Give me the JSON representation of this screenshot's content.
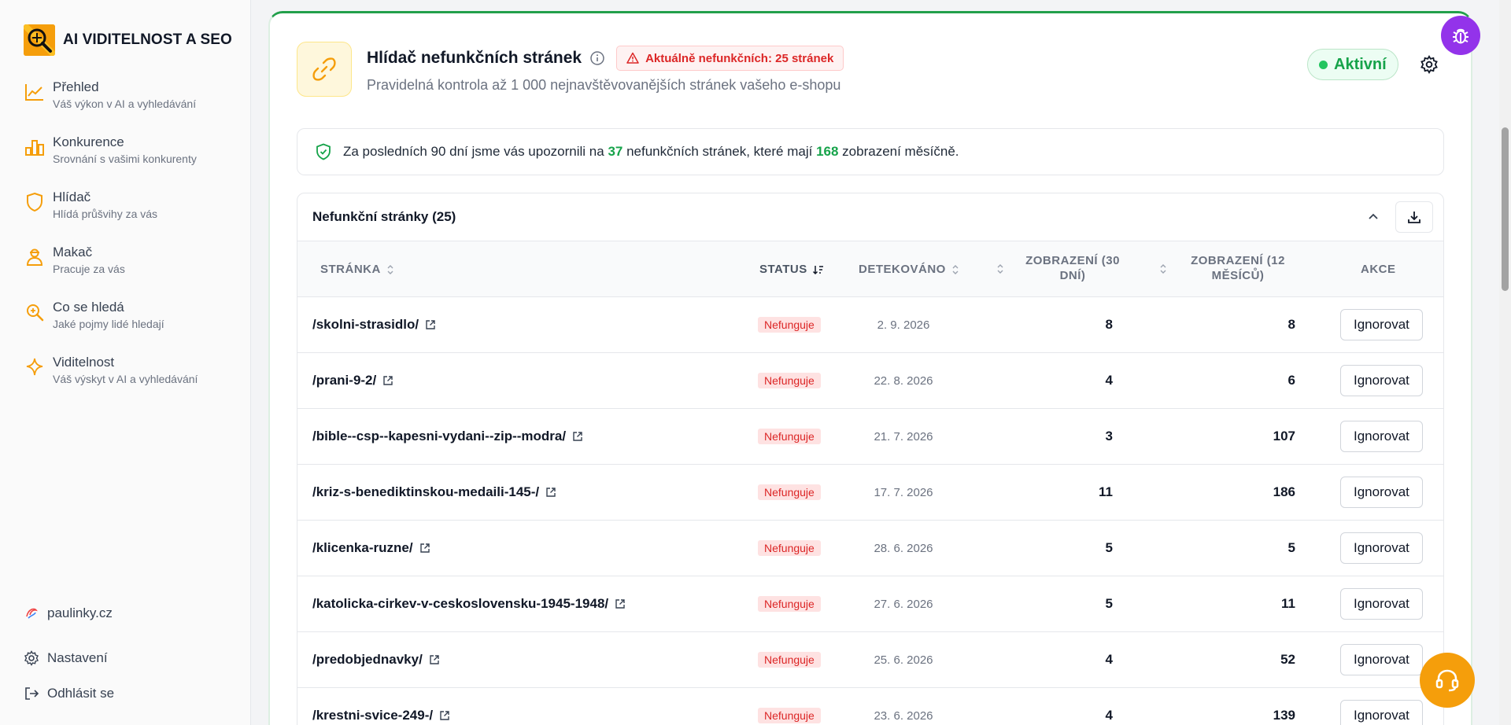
{
  "brand": {
    "name": "AI VIDITELNOST A SEO"
  },
  "nav": [
    {
      "title": "Přehled",
      "sub": "Váš výkon v AI a vyhledávání",
      "icon": "trend-chart-icon"
    },
    {
      "title": "Konkurence",
      "sub": "Srovnání s vašimi konkurenty",
      "icon": "bar-chart-icon"
    },
    {
      "title": "Hlídač",
      "sub": "Hlídá průšvihy za vás",
      "icon": "shield-icon"
    },
    {
      "title": "Makač",
      "sub": "Pracuje za vás",
      "icon": "worker-icon"
    },
    {
      "title": "Co se hledá",
      "sub": "Jaké pojmy lidé hledají",
      "icon": "search-icon"
    },
    {
      "title": "Viditelnost",
      "sub": "Váš výskyt v AI a vyhledávání",
      "icon": "sparkle-icon"
    }
  ],
  "sidebar_bottom": {
    "site": "paulinky.cz",
    "settings": "Nastavení",
    "logout": "Odhlásit se"
  },
  "header": {
    "title": "Hlídač nefunkčních stránek",
    "alert": "Aktuálně nefunkčních: 25 stránek",
    "subtitle": "Pravidelná kontrola až 1 000 nejnavštěvovanějších stránek vašeho e-shopu",
    "status": "Aktivní"
  },
  "notice": {
    "prefix": "Za posledních 90 dní jsme vás upozornili na",
    "pages": "37",
    "middle": "nefunkčních stránek, které mají",
    "views": "168",
    "suffix": "zobrazení měsíčně."
  },
  "table": {
    "title": "Nefunkční stránky (25)",
    "columns": {
      "page": "STRÁNKA",
      "status": "STATUS",
      "detected": "DETEKOVÁNO",
      "views30_l1": "ZOBRAZENÍ (30",
      "views30_l2": "DNÍ)",
      "views12_l1": "ZOBRAZENÍ (12",
      "views12_l2": "MĚSÍCŮ)",
      "actions": "AKCE"
    },
    "rows": [
      {
        "page": "/skolni-strasidlo/",
        "status": "Nefunguje",
        "detected": "2. 9. 2026",
        "v30": "8",
        "v12": "8",
        "action": "Ignorovat"
      },
      {
        "page": "/prani-9-2/",
        "status": "Nefunguje",
        "detected": "22. 8. 2026",
        "v30": "4",
        "v12": "6",
        "action": "Ignorovat"
      },
      {
        "page": "/bible--csp--kapesni-vydani--zip--modra/",
        "status": "Nefunguje",
        "detected": "21. 7. 2026",
        "v30": "3",
        "v12": "107",
        "action": "Ignorovat"
      },
      {
        "page": "/kriz-s-benediktinskou-medaili-145-/",
        "status": "Nefunguje",
        "detected": "17. 7. 2026",
        "v30": "11",
        "v12": "186",
        "action": "Ignorovat"
      },
      {
        "page": "/klicenka-ruzne/",
        "status": "Nefunguje",
        "detected": "28. 6. 2026",
        "v30": "5",
        "v12": "5",
        "action": "Ignorovat"
      },
      {
        "page": "/katolicka-cirkev-v-ceskoslovensku-1945-1948/",
        "status": "Nefunguje",
        "detected": "27. 6. 2026",
        "v30": "5",
        "v12": "11",
        "action": "Ignorovat"
      },
      {
        "page": "/predobjednavky/",
        "status": "Nefunguje",
        "detected": "25. 6. 2026",
        "v30": "4",
        "v12": "52",
        "action": "Ignorovat"
      },
      {
        "page": "/krestni-svice-249-/",
        "status": "Nefunguje",
        "detected": "23. 6. 2026",
        "v30": "4",
        "v12": "139",
        "action": "Ignorovat"
      }
    ]
  },
  "colors": {
    "accent": "#f59e0b",
    "success": "#16a34a",
    "danger": "#dc2626",
    "bug_fab": "#9333ea"
  }
}
